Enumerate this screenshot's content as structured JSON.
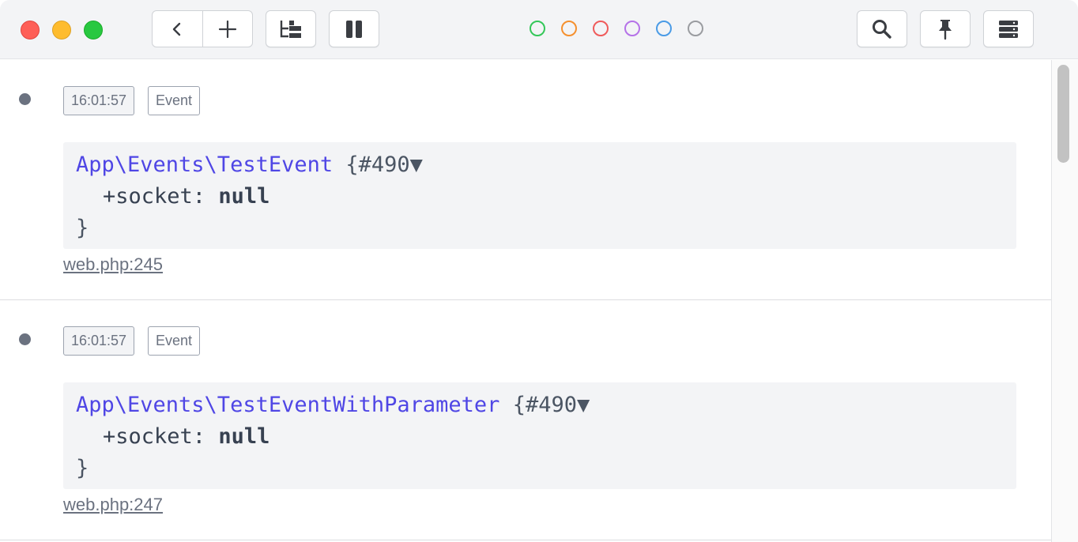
{
  "toolbar": {
    "back_icon": "chevron-left-icon",
    "add_icon": "plus-icon",
    "tree_icon": "tree-icon",
    "pause_icon": "pause-icon",
    "search_icon": "search-icon",
    "pin_icon": "pin-icon",
    "storage_icon": "server-icon"
  },
  "color_filters": [
    {
      "name": "green",
      "color": "#34c759"
    },
    {
      "name": "orange",
      "color": "#f5902e"
    },
    {
      "name": "red",
      "color": "#ef5b5b"
    },
    {
      "name": "purple",
      "color": "#b572e8"
    },
    {
      "name": "blue",
      "color": "#4a9be6"
    },
    {
      "name": "gray",
      "color": "#9a9ca0"
    }
  ],
  "entries": [
    {
      "time": "16:01:57",
      "type": "Event",
      "class_name": "App\\Events\\TestEvent",
      "object_ref": "{#490▼",
      "prop_name": "+socket:",
      "prop_value": "null",
      "close": "}",
      "file": "web.php:245"
    },
    {
      "time": "16:01:57",
      "type": "Event",
      "class_name": "App\\Events\\TestEventWithParameter",
      "object_ref": "{#490▼",
      "prop_name": "+socket:",
      "prop_value": "null",
      "close": "}",
      "file": "web.php:247"
    }
  ]
}
